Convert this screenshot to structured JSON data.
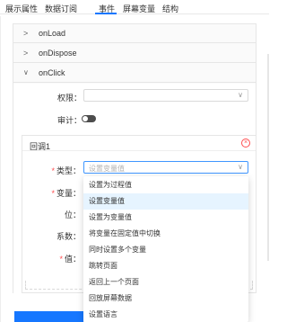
{
  "tabs": [
    "展示属性",
    "数据订阅",
    "事件",
    "屏幕变量",
    "结构"
  ],
  "active_tab": "事件",
  "events": [
    {
      "name": "onLoad",
      "expanded": false
    },
    {
      "name": "onDispose",
      "expanded": false
    },
    {
      "name": "onClick",
      "expanded": true
    }
  ],
  "onclick_form": {
    "permission_label": "权限：",
    "audit_label": "审计：",
    "audit_enabled": false
  },
  "callback": {
    "title": "回调1",
    "type_label": "类型：",
    "type_placeholder": "设置变量值",
    "variable_label": "变量：",
    "position_label": "位：",
    "coefficient_label": "系数：",
    "value_label": "值："
  },
  "dropdown_options": [
    "设置为过程值",
    "设置变量值",
    "设置为变量值",
    "将变量在固定值中切换",
    "同时设置多个变量",
    "跳转页面",
    "返回上一个页面",
    "回放屏幕数据",
    "设置语言"
  ],
  "selected_option_index": 1,
  "colors": {
    "accent": "#1677ff",
    "danger": "#ff4d4f"
  }
}
